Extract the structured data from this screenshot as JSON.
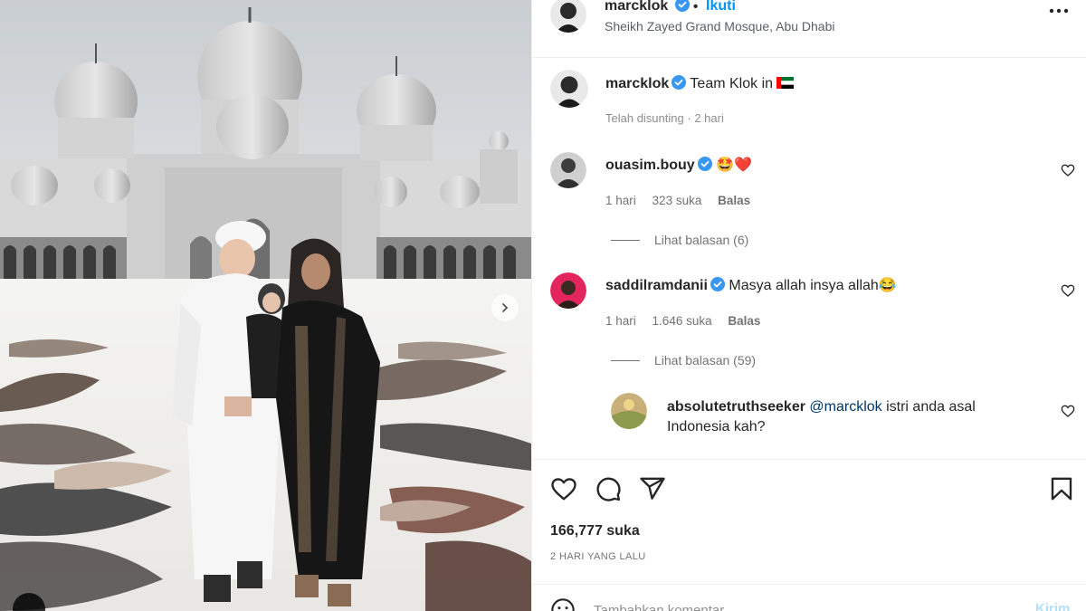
{
  "post": {
    "username": "marcklok",
    "follow_label": "Ikuti",
    "dot": "•",
    "location": "Sheikh Zayed Grand Mosque, Abu Dhabi"
  },
  "caption": {
    "username": "marcklok",
    "text": "Team Klok in",
    "flag": "uae-flag",
    "edited": "Telah disunting",
    "separator": "·",
    "time": "2 hari"
  },
  "comments": [
    {
      "username": "ouasim.bouy",
      "text": "🤩❤️",
      "time": "1 hari",
      "likes": "323 suka",
      "reply": "Balas",
      "view_replies": "Lihat balasan (6)"
    },
    {
      "username": "saddilramdanii",
      "text": "Masya allah insya allah😂",
      "time": "1 hari",
      "likes": "1.646 suka",
      "reply": "Balas",
      "view_replies": "Lihat balasan (59)"
    }
  ],
  "reply": {
    "username": "absolutetruthseeker",
    "mention": "@marcklok",
    "text_line1": "istri anda asal",
    "text_line2": "Indonesia kah?"
  },
  "likes_count": "166,777 suka",
  "posted_ago": "2 HARI YANG LALU",
  "composer": {
    "placeholder": "Tambahkan komentar...",
    "post_label": "Kirim"
  },
  "icons": {
    "verified": "verified-badge-icon",
    "more": "more-options-icon",
    "heart": "heart-icon",
    "comment": "comment-icon",
    "share": "share-icon",
    "save": "bookmark-icon",
    "emoji": "emoji-icon",
    "next": "chevron-right-icon"
  },
  "colors": {
    "link_blue": "#0095f6",
    "verified_blue": "#3897f0",
    "text": "#262626",
    "secondary": "#737373"
  }
}
